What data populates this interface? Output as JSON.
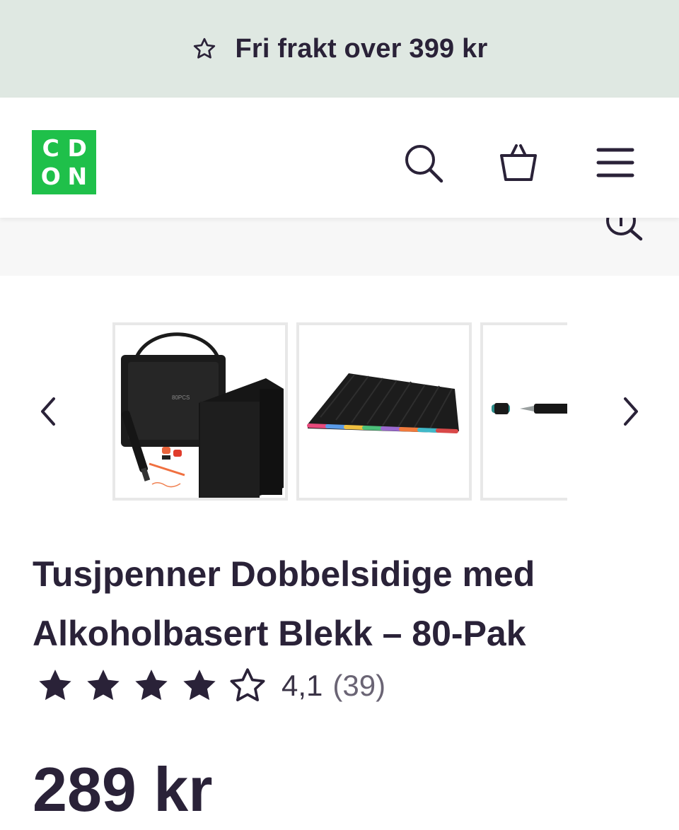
{
  "promo": {
    "icon": "star-outline-icon",
    "text": "Fri frakt over 399 kr"
  },
  "header": {
    "logo": {
      "letters": [
        "C",
        "D",
        "O",
        "N"
      ],
      "color": "#1fc04a"
    },
    "icons": [
      "search-icon",
      "basket-icon",
      "hamburger-menu-icon"
    ]
  },
  "gallery": {
    "zoom_icon": "zoom-in-icon",
    "thumbnails": [
      "marker-bag-set-image",
      "markers-pile-image",
      "single-marker-image"
    ],
    "prev_icon": "chevron-left-icon",
    "next_icon": "chevron-right-icon"
  },
  "product": {
    "title_line1": "Tusjpenner Dobbelsidige med",
    "title_line2": "Alkoholbasert Blekk – 80-Pak",
    "rating": {
      "value": 4.1,
      "display": "4,1",
      "count": "(39)",
      "max": 5
    },
    "price": "289 kr"
  },
  "colors": {
    "text": "#2a2238",
    "promo_bg": "#dfe8e2",
    "brand_green": "#1fc04a"
  }
}
